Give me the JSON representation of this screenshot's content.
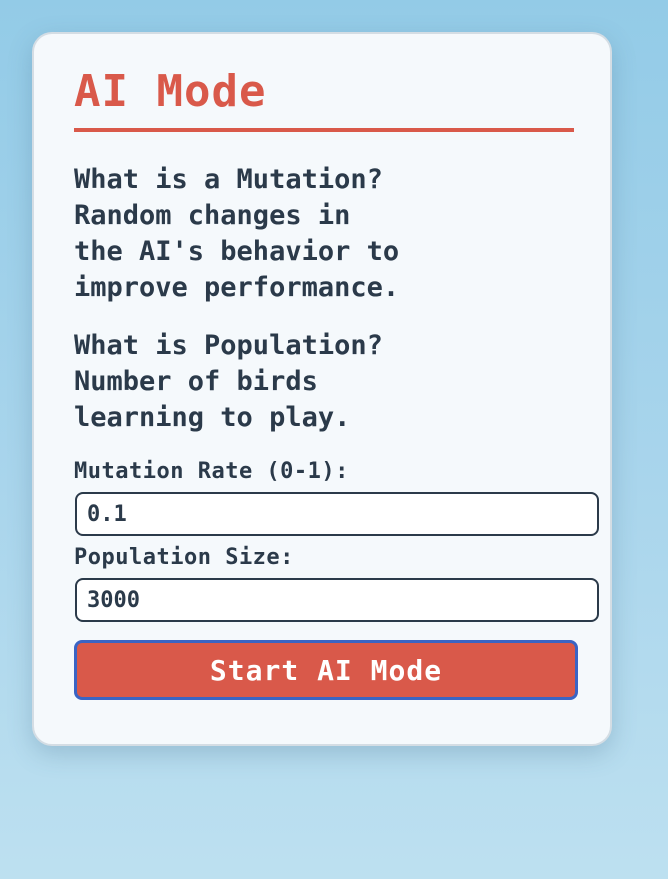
{
  "panel": {
    "title": "AI Mode",
    "mutation_info": "What is a Mutation?\nRandom changes in\nthe AI's behavior to\nimprove performance.",
    "population_info": "What is Population?\nNumber of birds\nlearning to play.",
    "mutation_label": "Mutation Rate (0-1):",
    "mutation_value": "0.1",
    "population_label": "Population Size:",
    "population_value": "3000",
    "start_button": "Start AI Mode"
  },
  "colors": {
    "accent": "#d9594a",
    "text": "#2b3a4a",
    "button_border": "#3a64c4",
    "card_background": "#f5f9fc",
    "page_background": "#a9d5ec"
  }
}
